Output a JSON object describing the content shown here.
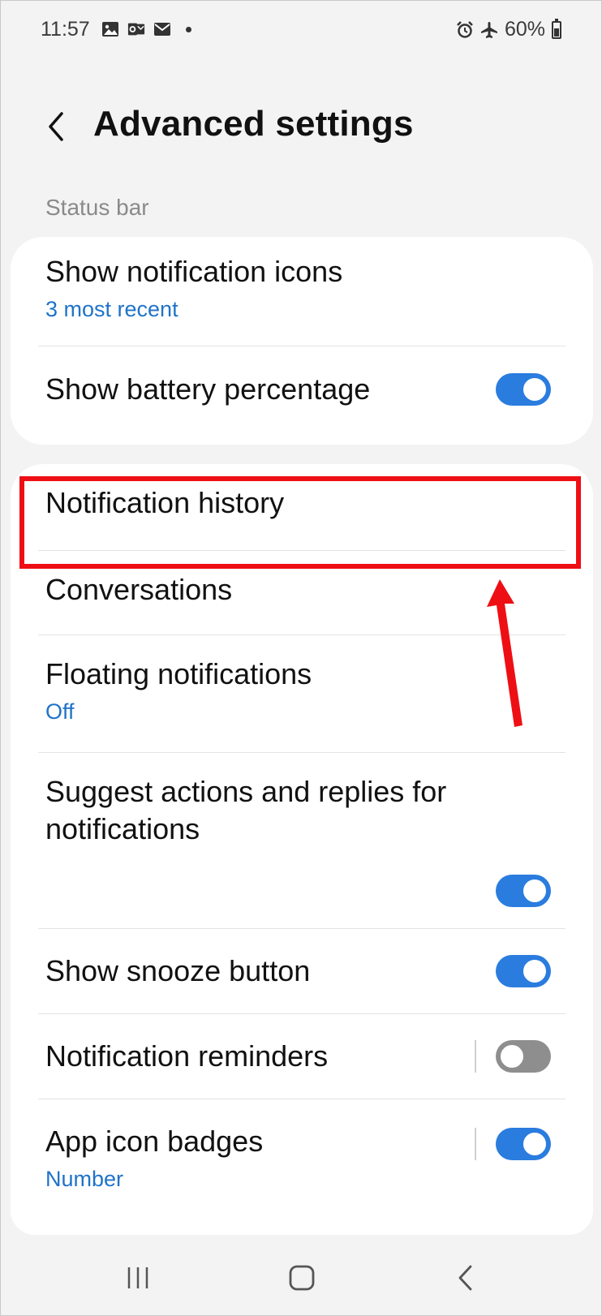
{
  "status_bar": {
    "time": "11:57",
    "left_icons": [
      "image-icon",
      "outlook-icon",
      "mail-icon"
    ],
    "right_icons": [
      "alarm-icon",
      "airplane-icon"
    ],
    "battery_text": "60%",
    "battery_level": 0.6
  },
  "header": {
    "title": "Advanced settings",
    "back_icon": "chevron-left-icon"
  },
  "sections": [
    {
      "label": "Status bar",
      "items": [
        {
          "title": "Show notification icons",
          "subtitle": "3 most recent"
        },
        {
          "title": "Show battery percentage",
          "toggle": true
        }
      ]
    },
    {
      "items": [
        {
          "title": "Notification history"
        },
        {
          "title": "Conversations"
        },
        {
          "title": "Floating notifications",
          "subtitle": "Off"
        },
        {
          "title": "Suggest actions and replies for notifications",
          "toggle": true
        },
        {
          "title": "Show snooze button",
          "toggle": true
        },
        {
          "title": "Notification reminders",
          "toggle": false
        },
        {
          "title": "App icon badges",
          "subtitle": "Number",
          "toggle": true
        }
      ]
    }
  ],
  "annotation": {
    "color": "#ee0f14",
    "target": "Notification history"
  },
  "colors": {
    "accent": "#2a7cde",
    "subtitle": "#1f73c8",
    "background": "#f3f3f3"
  },
  "nav_bar": {
    "buttons": [
      "recent-apps-icon",
      "home-icon",
      "back-icon"
    ]
  }
}
